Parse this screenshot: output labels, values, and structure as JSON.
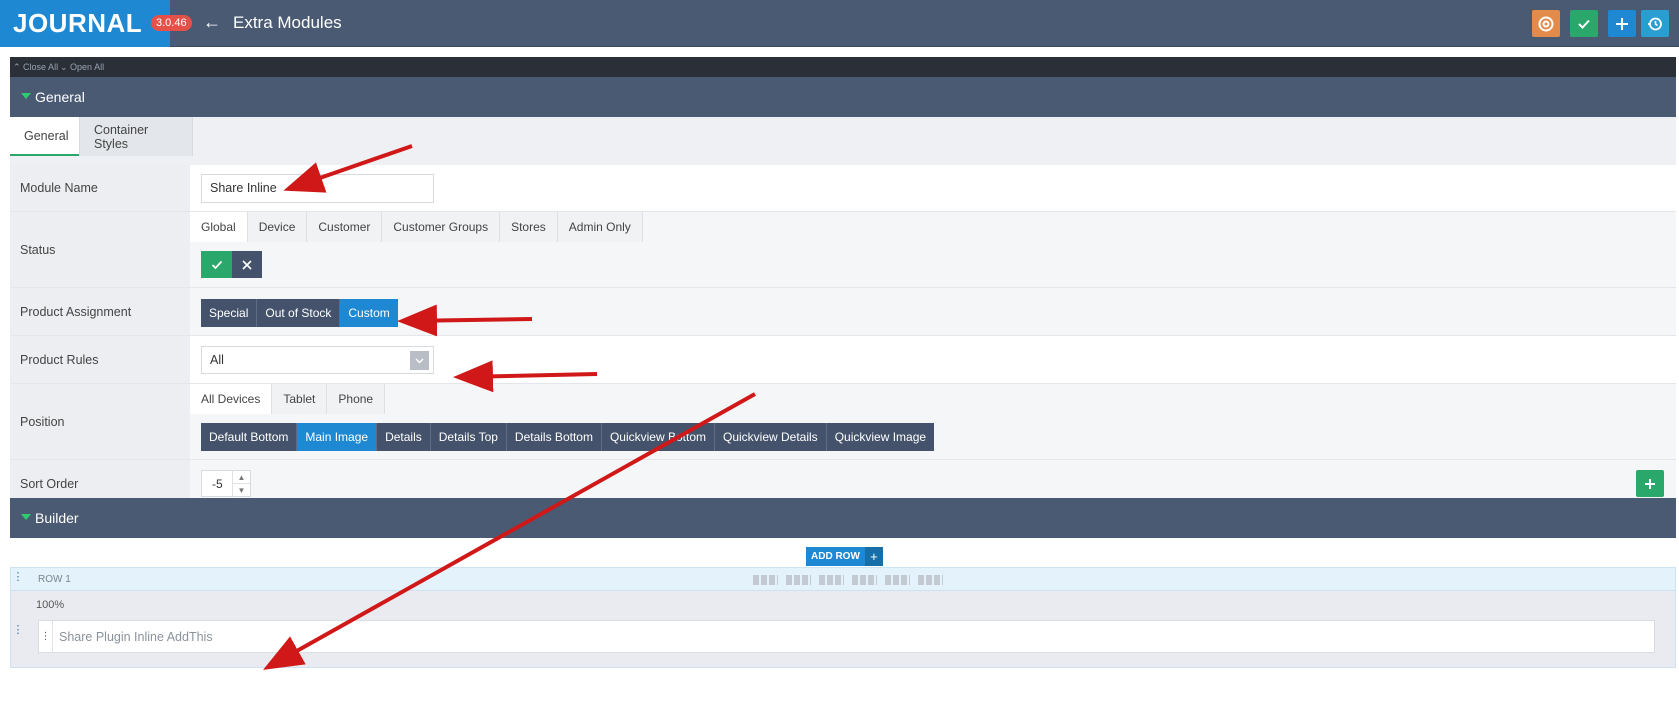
{
  "app": {
    "logo": "JOURNAL",
    "version": "3.0.46",
    "title": "Extra Modules"
  },
  "toolbar": {
    "icons": [
      "lifebuoy-icon",
      "check-icon",
      "plus-icon",
      "history-icon"
    ],
    "colors": {
      "orange": "#e38b4a",
      "green": "#2aa76a",
      "blue": "#1e88d3",
      "teal": "#2a9ed0"
    }
  },
  "strip": {
    "close_all": "Close All",
    "open_all": "Open All"
  },
  "sections": {
    "general": "General",
    "builder": "Builder"
  },
  "tabs": {
    "general": "General",
    "container_styles": "Container Styles"
  },
  "fields": {
    "module_name": {
      "label": "Module Name",
      "value": "Share Inline"
    },
    "status": {
      "label": "Status",
      "tabs": [
        "Global",
        "Device",
        "Customer",
        "Customer Groups",
        "Stores",
        "Admin Only"
      ]
    },
    "product_assignment": {
      "label": "Product Assignment",
      "options": [
        "Special",
        "Out of Stock",
        "Custom"
      ]
    },
    "product_rules": {
      "label": "Product Rules",
      "value": "All"
    },
    "position": {
      "label": "Position",
      "tabs": [
        "All Devices",
        "Tablet",
        "Phone"
      ],
      "options": [
        "Default Bottom",
        "Main Image",
        "Details",
        "Details Top",
        "Details Bottom",
        "Quickview Bottom",
        "Quickview Details",
        "Quickview Image"
      ]
    },
    "sort_order": {
      "label": "Sort Order",
      "value": "-5"
    }
  },
  "builder": {
    "add_row": "ADD ROW",
    "row_label": "ROW 1",
    "column_width": "100%",
    "module": "Share Plugin Inline AddThis"
  }
}
